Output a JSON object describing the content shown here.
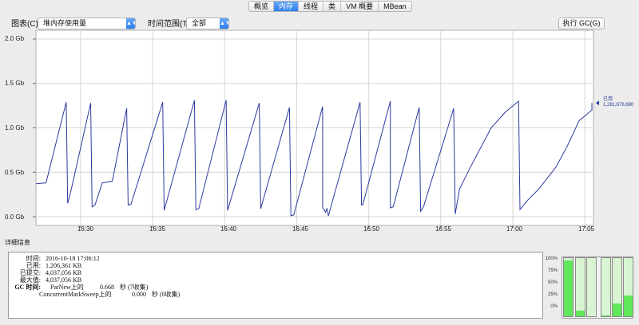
{
  "tabs": [
    {
      "label": "概览",
      "active": false
    },
    {
      "label": "内存",
      "active": true
    },
    {
      "label": "线程",
      "active": false
    },
    {
      "label": "类",
      "active": false
    },
    {
      "label": "VM 概要",
      "active": false
    },
    {
      "label": "MBean",
      "active": false
    }
  ],
  "controls": {
    "chart_label": "图表(C):",
    "chart_value": "堆内存使用量",
    "range_label": "时间范围(T):",
    "range_value": "全部",
    "gc_button": "执行 GC(G)"
  },
  "chart_data": {
    "type": "line",
    "title": "",
    "xlabel": "",
    "ylabel": "",
    "y_ticks": [
      {
        "value": 2.0,
        "label": "2.0 Gb"
      },
      {
        "value": 1.5,
        "label": "1.5 Gb"
      },
      {
        "value": 1.0,
        "label": "1.0 Gb"
      },
      {
        "value": 0.5,
        "label": "0.5 Gb"
      },
      {
        "value": 0.0,
        "label": "0.0 Gb"
      }
    ],
    "x_ticks": [
      "16:30",
      "16:35",
      "16:40",
      "16:45",
      "16:50",
      "16:55",
      "17:00",
      "17:05"
    ],
    "x_tick_minutes": [
      30,
      35,
      40,
      45,
      50,
      55,
      60,
      65
    ],
    "ylim": [
      0,
      2.0
    ],
    "xlim_minutes": [
      26.9,
      65.6
    ],
    "grid": true,
    "series": [
      {
        "name": "已用",
        "color": "#2b3aa0",
        "points": [
          [
            26.9,
            0.37
          ],
          [
            27.6,
            0.38
          ],
          [
            29.0,
            1.29
          ],
          [
            29.1,
            0.15
          ],
          [
            29.3,
            0.27
          ],
          [
            30.7,
            1.28
          ],
          [
            30.8,
            0.11
          ],
          [
            31.0,
            0.13
          ],
          [
            31.5,
            0.38
          ],
          [
            32.2,
            0.4
          ],
          [
            33.2,
            1.22
          ],
          [
            33.3,
            0.13
          ],
          [
            33.5,
            0.14
          ],
          [
            35.7,
            1.29
          ],
          [
            35.8,
            0.07
          ],
          [
            37.9,
            1.31
          ],
          [
            38.0,
            0.08
          ],
          [
            38.2,
            0.09
          ],
          [
            40.1,
            1.31
          ],
          [
            40.2,
            0.07
          ],
          [
            42.4,
            1.28
          ],
          [
            42.5,
            0.09
          ],
          [
            44.5,
            1.23
          ],
          [
            44.6,
            0.01
          ],
          [
            44.8,
            0.02
          ],
          [
            46.8,
            1.24
          ],
          [
            46.8,
            0.1
          ],
          [
            46.9,
            0.08
          ],
          [
            47.0,
            0.05
          ],
          [
            47.1,
            0.09
          ],
          [
            47.2,
            0.01
          ],
          [
            49.4,
            1.29
          ],
          [
            49.5,
            0.13
          ],
          [
            49.6,
            0.14
          ],
          [
            51.5,
            1.3
          ],
          [
            51.5,
            0.1
          ],
          [
            51.7,
            0.11
          ],
          [
            53.5,
            1.23
          ],
          [
            53.6,
            0.06
          ],
          [
            53.8,
            0.11
          ],
          [
            55.9,
            1.22
          ],
          [
            56.0,
            0.03
          ],
          [
            56.3,
            0.31
          ],
          [
            57.0,
            0.54
          ],
          [
            58.5,
            1.0
          ],
          [
            59.5,
            1.18
          ],
          [
            60.4,
            1.3
          ],
          [
            60.5,
            0.08
          ],
          [
            61.0,
            0.18
          ],
          [
            61.8,
            0.31
          ],
          [
            63.0,
            0.56
          ],
          [
            63.8,
            0.8
          ],
          [
            64.6,
            1.08
          ],
          [
            66.1,
            1.2
          ],
          [
            67.2,
            1.28
          ]
        ]
      }
    ],
    "legend": {
      "name": "已用",
      "value": "1,281,676,680",
      "placement": "right"
    }
  },
  "details": {
    "title": "详细信息",
    "rows": [
      {
        "label": "时间:",
        "value": "2016-10-18 17:06:12"
      },
      {
        "label": "已用:",
        "value": "1,206,361 KB"
      },
      {
        "label": "已提交:",
        "value": "4,037,056 KB"
      },
      {
        "label": "最大值:",
        "value": "4,037,056 KB"
      }
    ],
    "gc_label": "GC 时间:",
    "gc_rows": [
      {
        "name": "ParNew上的",
        "value": "0.668",
        "unit": "秒 (7收集)"
      },
      {
        "name": "ConcurrentMarkSweep上的",
        "value": "0.000",
        "unit": "秒 (0收集)"
      }
    ]
  },
  "pool_gauges": {
    "axis_labels": [
      "100%",
      "75%",
      "50%",
      "25%",
      "0%"
    ],
    "fill_percent": [
      96,
      10,
      0,
      2,
      22,
      35
    ],
    "fill_color": "#5ee85a",
    "empty_color": "#d8f4d2"
  }
}
